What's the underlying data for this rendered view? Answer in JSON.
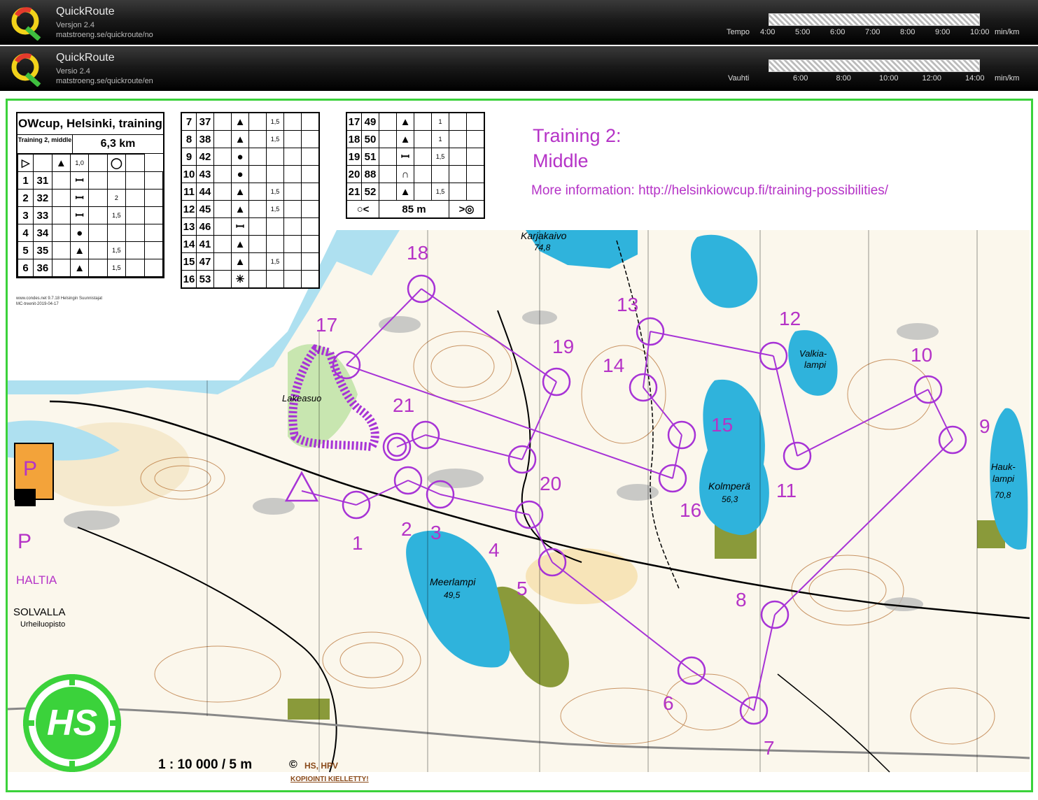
{
  "header_no": {
    "app": "QuickRoute",
    "version": "Versjon 2.4",
    "url": "matstroeng.se/quickroute/no",
    "scale_label": "Tempo",
    "ticks": [
      "4:00",
      "5:00",
      "6:00",
      "7:00",
      "8:00",
      "9:00",
      "10:00"
    ],
    "unit": "min/km"
  },
  "header_en": {
    "app": "QuickRoute",
    "version": "Versio 2.4",
    "url": "matstroeng.se/quickroute/en",
    "scale_label": "Vauhti",
    "ticks": [
      "6:00",
      "8:00",
      "10:00",
      "12:00",
      "14:00"
    ],
    "unit": "min/km"
  },
  "event": {
    "title": "OWcup, Helsinki, training",
    "class": "Training 2, middle",
    "length": "6,3 km",
    "credit1": "www.condes.net 9.7.18 Helsingin Suunnistajat",
    "credit2": "MC-treenit-2019-04-17"
  },
  "controls": [
    {
      "n": "1",
      "code": "31",
      "sym": "ꟷ",
      "extra": ""
    },
    {
      "n": "2",
      "code": "32",
      "sym": "ꟷ",
      "extra": "2"
    },
    {
      "n": "3",
      "code": "33",
      "sym": "ꟷ",
      "extra": "1,5"
    },
    {
      "n": "4",
      "code": "34",
      "sym": "●",
      "extra": ""
    },
    {
      "n": "5",
      "code": "35",
      "sym": "▲",
      "extra": "1,5"
    },
    {
      "n": "6",
      "code": "36",
      "sym": "▲",
      "extra": "1,5"
    },
    {
      "n": "7",
      "code": "37",
      "sym": "▲",
      "extra": "1,5"
    },
    {
      "n": "8",
      "code": "38",
      "sym": "▲",
      "extra": "1,5"
    },
    {
      "n": "9",
      "code": "42",
      "sym": "●",
      "extra": ""
    },
    {
      "n": "10",
      "code": "43",
      "sym": "●",
      "extra": ""
    },
    {
      "n": "11",
      "code": "44",
      "sym": "▲",
      "extra": "1,5"
    },
    {
      "n": "12",
      "code": "45",
      "sym": "▲",
      "extra": "1,5"
    },
    {
      "n": "13",
      "code": "46",
      "sym": "ꟷ",
      "extra": ""
    },
    {
      "n": "14",
      "code": "41",
      "sym": "▲",
      "extra": ""
    },
    {
      "n": "15",
      "code": "47",
      "sym": "▲",
      "extra": "1,5"
    },
    {
      "n": "16",
      "code": "53",
      "sym": "✳",
      "extra": ""
    },
    {
      "n": "17",
      "code": "49",
      "sym": "▲",
      "extra": "1"
    },
    {
      "n": "18",
      "code": "50",
      "sym": "▲",
      "extra": "1"
    },
    {
      "n": "19",
      "code": "51",
      "sym": "ꟷ",
      "extra": "1,5"
    },
    {
      "n": "20",
      "code": "88",
      "sym": "∩",
      "extra": ""
    },
    {
      "n": "21",
      "code": "52",
      "sym": "▲",
      "extra": "1,5"
    }
  ],
  "start_row": {
    "extra": "1,0"
  },
  "finish_row": {
    "dist": "85 m"
  },
  "info": {
    "line1": "Training 2:",
    "line2": "Middle",
    "line3": "More information: http://helsinkiowcup.fi/training-possibilities/"
  },
  "map_labels": {
    "karjakaivo": "Karjakaivo",
    "karjakaivo_h": "74,8",
    "lakeasuo": "Lakeasuo",
    "valkia": "Valkia-",
    "valkia2": "lampi",
    "kolmpera": "Kolmperä",
    "kolmpera_h": "56,3",
    "hauk": "Hauk-",
    "hauk2": "lampi",
    "hauk_h": "70,8",
    "meerlampi": "Meerlampi",
    "meerlampi_h": "49,5",
    "parking1": "P",
    "parking2": "P",
    "haltia": "HALTIA",
    "solvalla": "SOLVALLA",
    "urheilu": "Urheiluopisto",
    "scale": "1 : 10 000 / 5 m",
    "copy": "HS, HPV",
    "kielletty": "KOPIOINTI  KIELLETTY!",
    "logo": "HS"
  },
  "course_numbers": [
    "1",
    "2",
    "3",
    "4",
    "5",
    "6",
    "7",
    "8",
    "9",
    "10",
    "11",
    "12",
    "13",
    "14",
    "15",
    "16",
    "17",
    "18",
    "19",
    "20",
    "21"
  ],
  "colors": {
    "course": "#a733d6",
    "water": "#2fb3dc",
    "frame": "#3bd23b"
  }
}
